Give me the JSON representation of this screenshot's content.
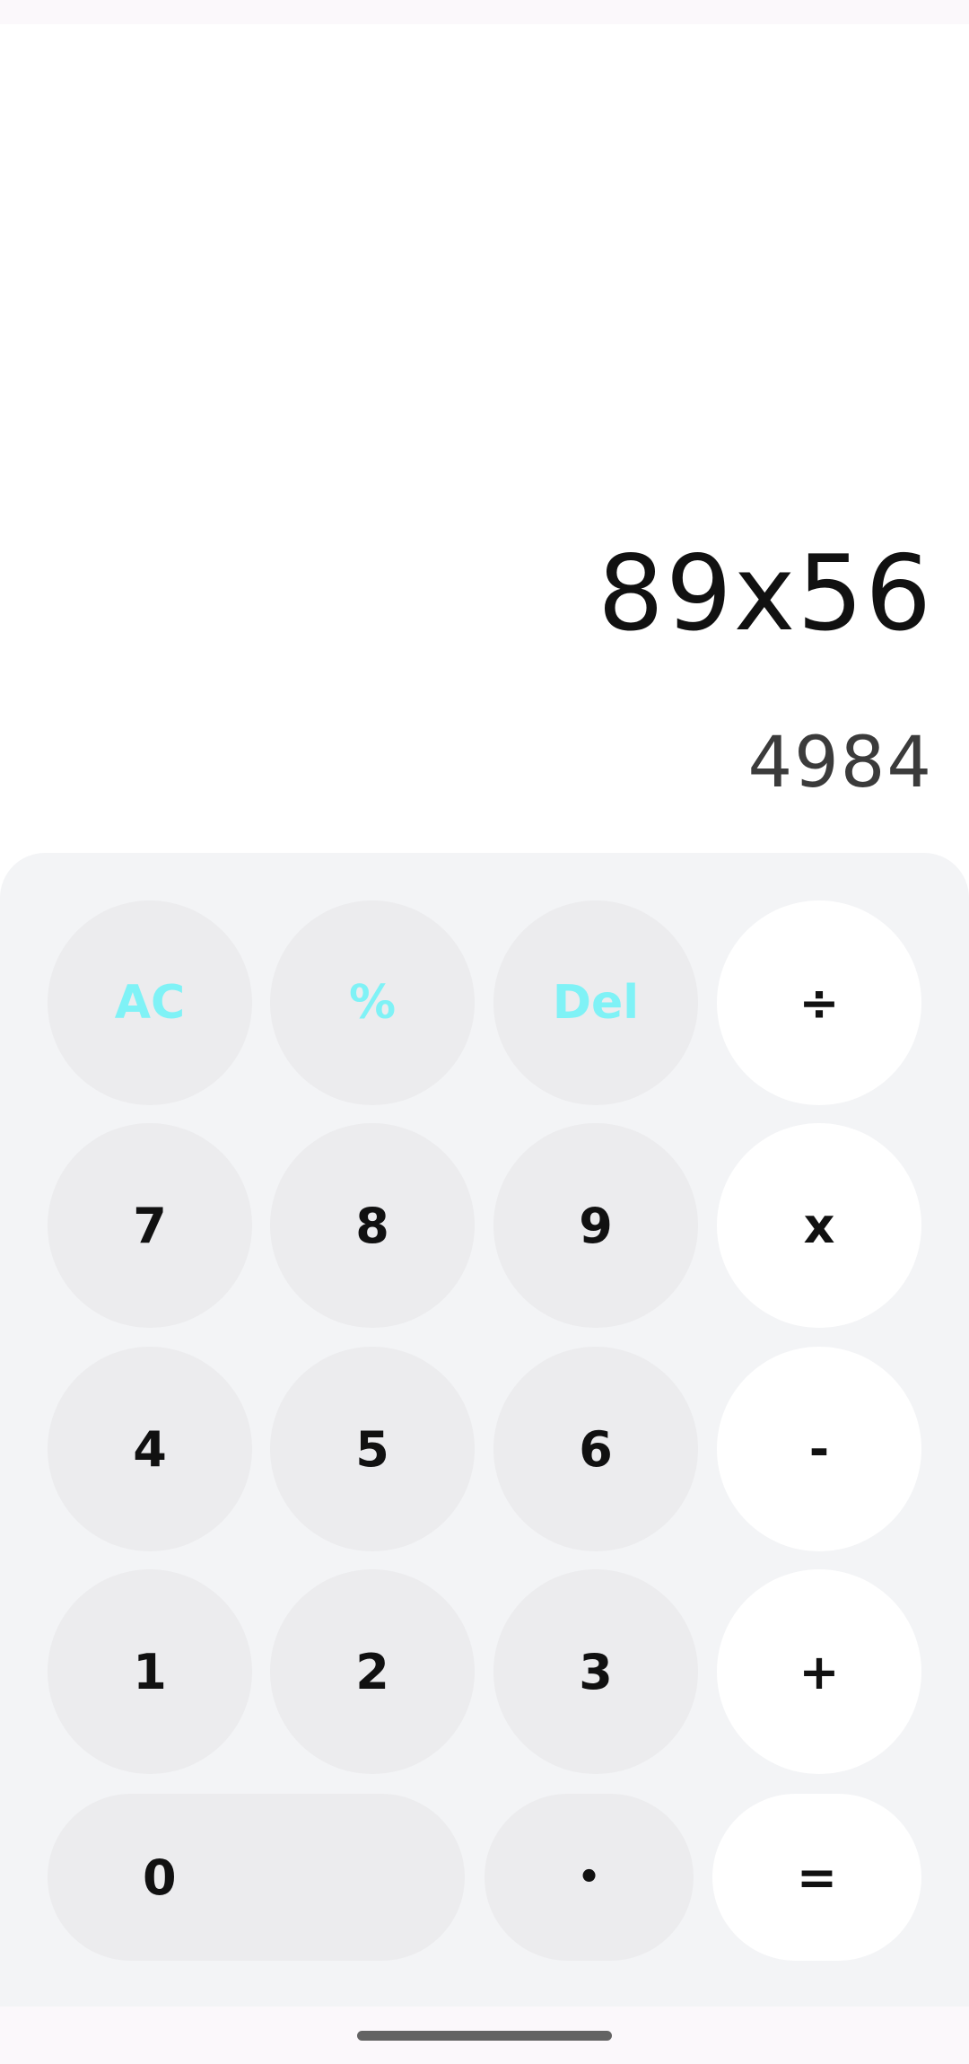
{
  "display": {
    "expression": "89x56",
    "result": "4984"
  },
  "keys": {
    "clear": "AC",
    "percent": "%",
    "delete": "Del",
    "divide": "÷",
    "seven": "7",
    "eight": "8",
    "nine": "9",
    "multiply": "x",
    "four": "4",
    "five": "5",
    "six": "6",
    "subtract": "-",
    "one": "1",
    "two": "2",
    "three": "3",
    "add": "+",
    "zero": "0",
    "decimal": "•",
    "equals": "="
  },
  "colors": {
    "function_key_text": "#7ff2f6",
    "digit_key_bg": "#ececee",
    "operator_key_bg": "#ffffff",
    "keypad_bg": "#f3f4f6"
  }
}
